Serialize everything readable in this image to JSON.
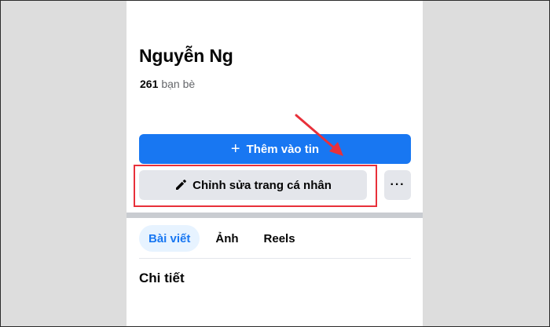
{
  "profile": {
    "name": "Nguyễn Ng",
    "friends_count": "261",
    "friends_label": "bạn bè"
  },
  "actions": {
    "add_story_icon": "plus-icon",
    "add_story_label": "Thêm vào tin",
    "edit_profile_icon": "pencil-icon",
    "edit_profile_label": "Chỉnh sửa trang cá nhân",
    "more_label": "···"
  },
  "tabs": [
    {
      "label": "Bài viết",
      "active": true
    },
    {
      "label": "Ảnh",
      "active": false
    },
    {
      "label": "Reels",
      "active": false
    }
  ],
  "section": {
    "details_title": "Chi tiết"
  },
  "colors": {
    "primary_blue": "#1877f2",
    "secondary_button": "#e4e6eb",
    "annotation_red": "#e8303a",
    "active_tab_bg": "#e7f3ff",
    "side_margin": "#dddddd"
  }
}
